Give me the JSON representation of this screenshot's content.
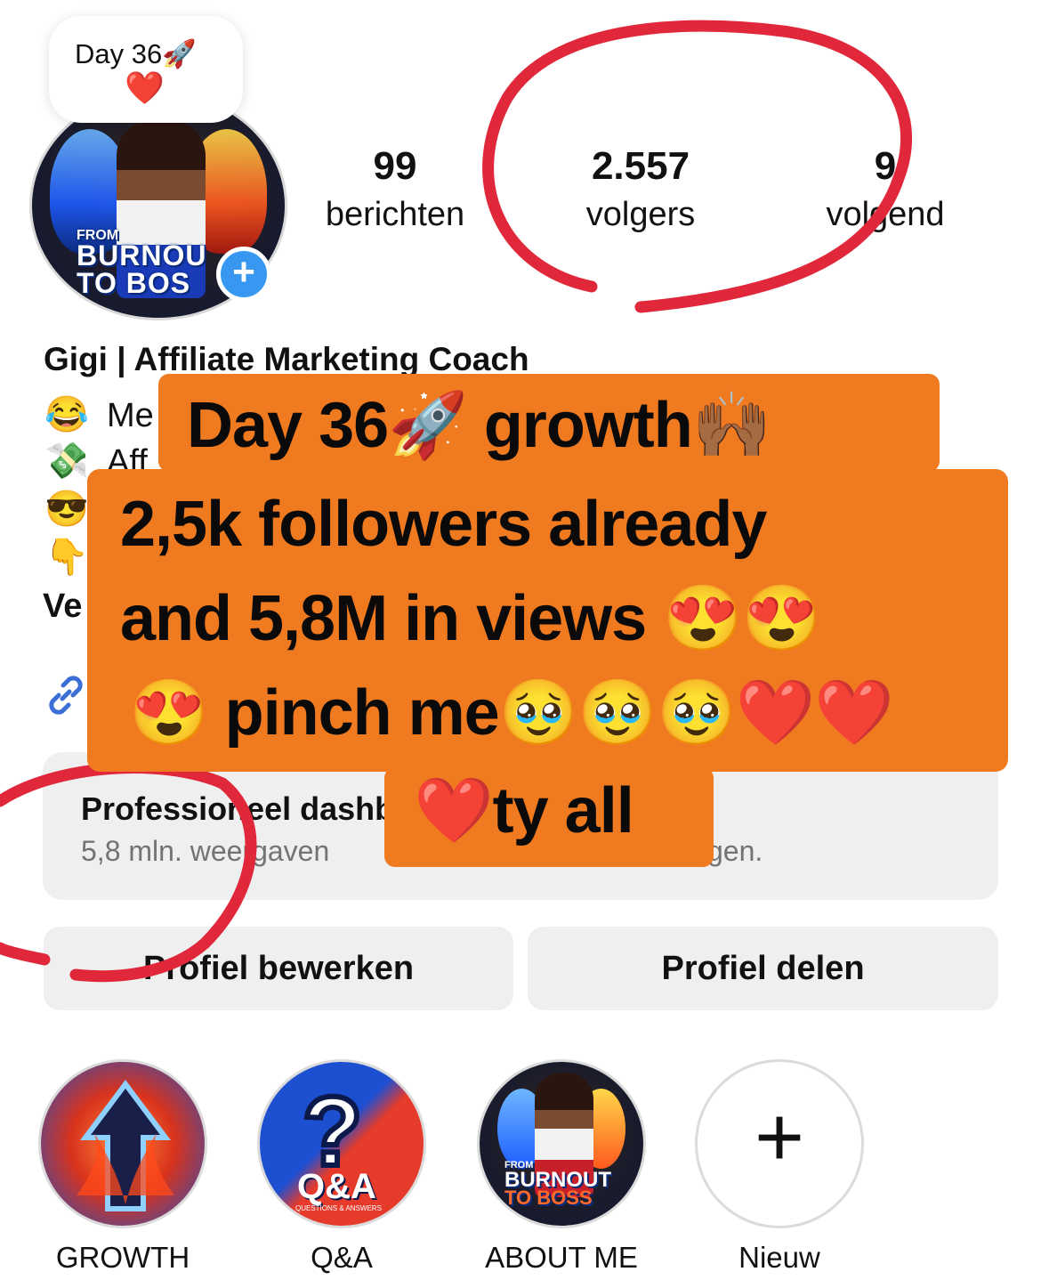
{
  "profile": {
    "note_text": "Day 36🚀",
    "note_emoji": "❤️",
    "avatar_small_text": "FROM",
    "avatar_big_text_1": "BURNOU",
    "avatar_big_text_2": "TO BOS",
    "add_story": "+"
  },
  "stats": [
    {
      "value": "99",
      "label": "berichten"
    },
    {
      "value": "2.557",
      "label": "volgers"
    },
    {
      "value": "9",
      "label": "volgend"
    }
  ],
  "bio": {
    "name": "Gigi | Affiliate Marketing Coach",
    "line1_emoji": "😂",
    "line1_text": "Me",
    "line2_emoji": "💸",
    "line2_text": "Aff",
    "line3_emoji": "😎",
    "line4_emoji": "👇",
    "line5_text": "Ve",
    "link_icon": "link-icon"
  },
  "dashboard": {
    "title": "Professioneel dashboard",
    "subtitle": "5,8 mln. weergaven",
    "subtitle_end": "gen."
  },
  "buttons": {
    "edit_profile": "Profiel bewerken",
    "share_profile": "Profiel delen"
  },
  "highlights": [
    {
      "label": "GROWTH"
    },
    {
      "label": "Q&A"
    },
    {
      "label": "ABOUT ME"
    },
    {
      "label": "Nieuw"
    }
  ],
  "highlight_art": {
    "qa_big": "Q&A",
    "qa_small": "QUESTIONS & ANSWERS",
    "qa_mark": "?",
    "about_small": "FROM",
    "about_big": "BURNOUT",
    "about_big2": "TO BOSS",
    "new_plus": "+"
  },
  "caption": {
    "line1": "Day 36🚀 growth🙌🏾",
    "line2": "2,5k followers already",
    "line3": "and 5,8M in views 😍😍",
    "line4": "😍 pinch me🥹🥹🥹❤️❤️",
    "line5": "❤️ty all"
  },
  "colors": {
    "caption_bg": "#f07a1f",
    "annotation_red": "#e0283a",
    "button_bg": "#efefef",
    "badge_blue": "#3897f0"
  }
}
